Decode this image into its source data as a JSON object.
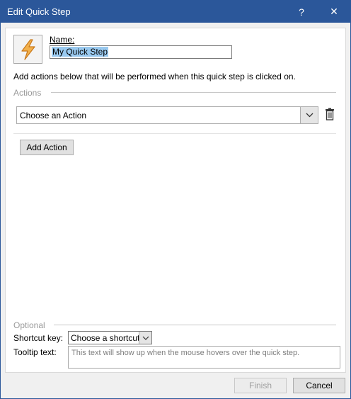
{
  "window": {
    "title": "Edit Quick Step",
    "help_label": "?",
    "close_label": "✕"
  },
  "name": {
    "label": "Name:",
    "value": "My Quick Step"
  },
  "instructions": "Add actions below that will be performed when this quick step is clicked on.",
  "actions": {
    "section_label": "Actions",
    "select_value": "Choose an Action",
    "add_button": "Add Action"
  },
  "optional": {
    "section_label": "Optional",
    "shortcut_label": "Shortcut key:",
    "shortcut_value": "Choose a shortcut",
    "tooltip_label": "Tooltip text:",
    "tooltip_placeholder": "This text will show up when the mouse hovers over the quick step."
  },
  "footer": {
    "finish": "Finish",
    "cancel": "Cancel"
  },
  "icons": {
    "quick_step": "lightning-bolt-icon",
    "dropdown": "chevron-down-icon",
    "delete": "trash-icon"
  },
  "colors": {
    "titlebar": "#2b579a",
    "bolt": "#e8a33d"
  }
}
